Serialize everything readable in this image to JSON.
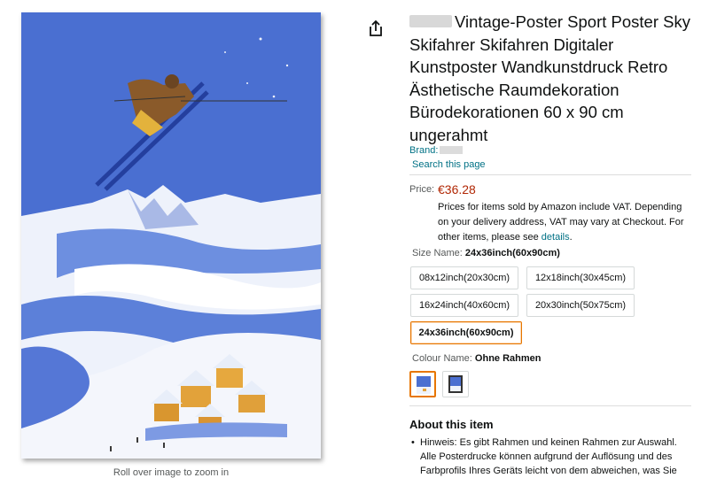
{
  "product": {
    "title": "Vintage-Poster Sport Poster Sky Skifahrer Skifahren Digitaler Kunstposter Wandkunstdruck Retro Ästhetische Raumdekoration Bürodekorationen 60 x 90 cm ungerahmt",
    "brand_label": "Brand:",
    "search_link": "Search this page"
  },
  "image": {
    "zoom_hint": "Roll over image to zoom in"
  },
  "price": {
    "label": "Price:",
    "value": "€36.28",
    "vat_note": "Prices for items sold by Amazon include VAT. Depending on your delivery address, VAT may vary at Checkout. For other items, please see",
    "details_link": "details",
    "period": "."
  },
  "size": {
    "label": "Size Name:",
    "selected": "24x36inch(60x90cm)",
    "options": [
      "08x12inch(20x30cm)",
      "12x18inch(30x45cm)",
      "16x24inch(40x60cm)",
      "20x30inch(50x75cm)",
      "24x36inch(60x90cm)"
    ]
  },
  "colour": {
    "label": "Colour Name:",
    "selected": "Ohne Rahmen"
  },
  "about": {
    "heading": "About this item",
    "bullets": [
      "Hinweis: Es gibt Rahmen und keinen Rahmen zur Auswahl. Alle Posterdrucke können aufgrund der Auflösung und des Farbprofils Ihres Geräts leicht von dem abweichen, was Sie"
    ]
  },
  "colors": {
    "price": "#b12704",
    "link": "#007185",
    "selected_border": "#e77600",
    "poster_sky": "#4a6fd1"
  },
  "icons": {
    "share": "share-icon"
  }
}
